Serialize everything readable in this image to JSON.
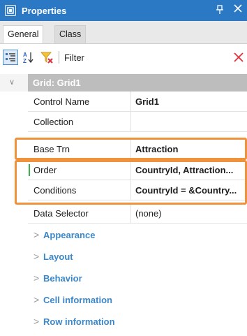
{
  "window": {
    "title": "Properties",
    "pin_glyph": "ᵖ",
    "close_glyph": "×",
    "title_icon": "properties-icon"
  },
  "tabs": [
    {
      "label": "General"
    },
    {
      "label": "Class"
    }
  ],
  "toolbar": {
    "categorized_icon": "categorized-icon",
    "alphabetical_icon": "alphabetical-sort-icon",
    "filter_icon": "filter-icon",
    "filter_label": "Filter",
    "filter_value": "",
    "clear_icon": "close-icon",
    "clear_glyph": "✕"
  },
  "grid_header": {
    "chevron": "∨",
    "title": "Grid: Grid1"
  },
  "properties": [
    {
      "name": "Control Name",
      "value": "Grid1",
      "bold": true
    },
    {
      "name": "Collection",
      "value": "",
      "bold": false
    },
    {
      "name": "Base Trn",
      "value": "Attraction",
      "bold": true
    },
    {
      "name": "Order",
      "value": "CountryId, Attraction...",
      "bold": true
    },
    {
      "name": "Conditions",
      "value": "CountryId = &Country...",
      "bold": true
    },
    {
      "name": "Data Selector",
      "value": "(none)",
      "bold": false
    }
  ],
  "categories": [
    {
      "label": "Appearance",
      "chevron": ">"
    },
    {
      "label": "Layout",
      "chevron": ">"
    },
    {
      "label": "Behavior",
      "chevron": ">"
    },
    {
      "label": "Cell information",
      "chevron": ">"
    },
    {
      "label": "Row information",
      "chevron": ">"
    }
  ],
  "colors": {
    "titlebar": "#2b79c4",
    "highlight": "#f0913c",
    "category_text": "#3a87c9",
    "modified_marker": "#3cb34a",
    "clear_button": "#e0303a"
  }
}
